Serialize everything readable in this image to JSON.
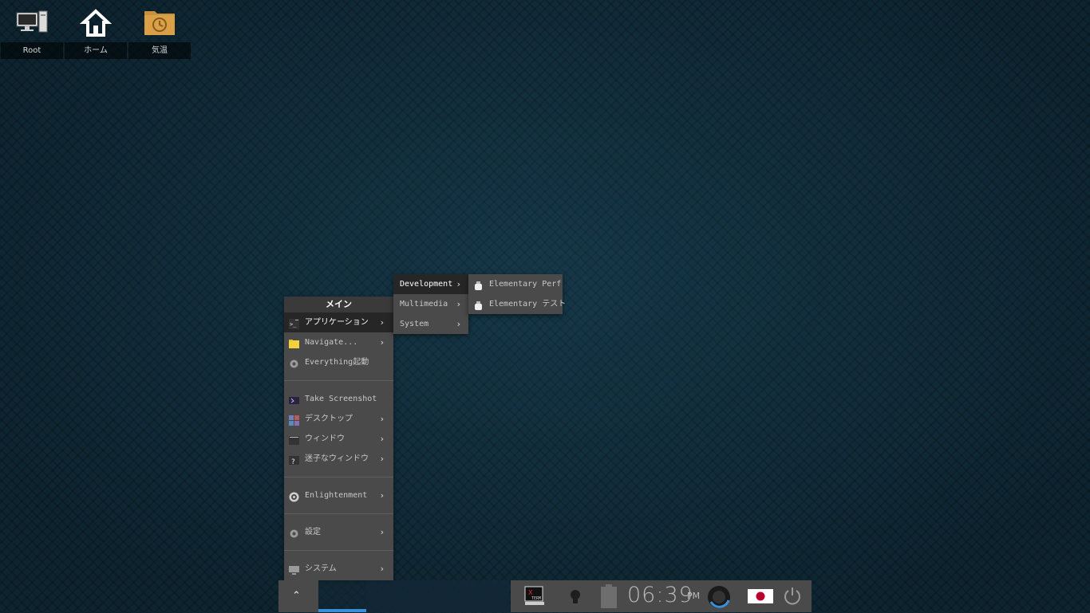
{
  "desktop": {
    "icons": [
      {
        "label": "Root"
      },
      {
        "label": "ホーム"
      },
      {
        "label": "気温"
      }
    ]
  },
  "main_menu": {
    "title": "メイン",
    "items": [
      {
        "label": "アプリケーション",
        "icon": "terminal-app-icon"
      },
      {
        "label": "Navigate...",
        "icon": "folder-icon"
      },
      {
        "label": "Everything起動",
        "icon": "gear-icon"
      },
      {
        "label": "Take Screenshot",
        "icon": "screenshot-icon"
      },
      {
        "label": "デスクトップ",
        "icon": "desktop-grid-icon"
      },
      {
        "label": "ウィンドウ",
        "icon": "window-icon"
      },
      {
        "label": "迷子なウィンドウ",
        "icon": "lost-window-icon"
      },
      {
        "label": "Enlightenment",
        "icon": "enlightenment-icon"
      },
      {
        "label": "設定",
        "icon": "settings-gear-icon"
      },
      {
        "label": "システム",
        "icon": "monitor-icon"
      }
    ]
  },
  "apps_menu": {
    "items": [
      {
        "label": "Development"
      },
      {
        "label": "Multimedia"
      },
      {
        "label": "System"
      }
    ]
  },
  "dev_menu": {
    "items": [
      {
        "label": "Elementary Perf",
        "icon": "elementary-icon"
      },
      {
        "label": "Elementary テスト",
        "icon": "elementary-icon"
      }
    ]
  },
  "shelf": {
    "clock_time": "06:39",
    "clock_ampm": "PM",
    "apps": [
      "xterm-icon",
      "lightbulb-icon",
      "battery-icon",
      "mixer-icon",
      "japan-flag-icon",
      "power-icon"
    ]
  },
  "colors": {
    "menu_bg": "#4a4a4a",
    "menu_active": "#262626",
    "pager_active": "#3a8fd9"
  }
}
